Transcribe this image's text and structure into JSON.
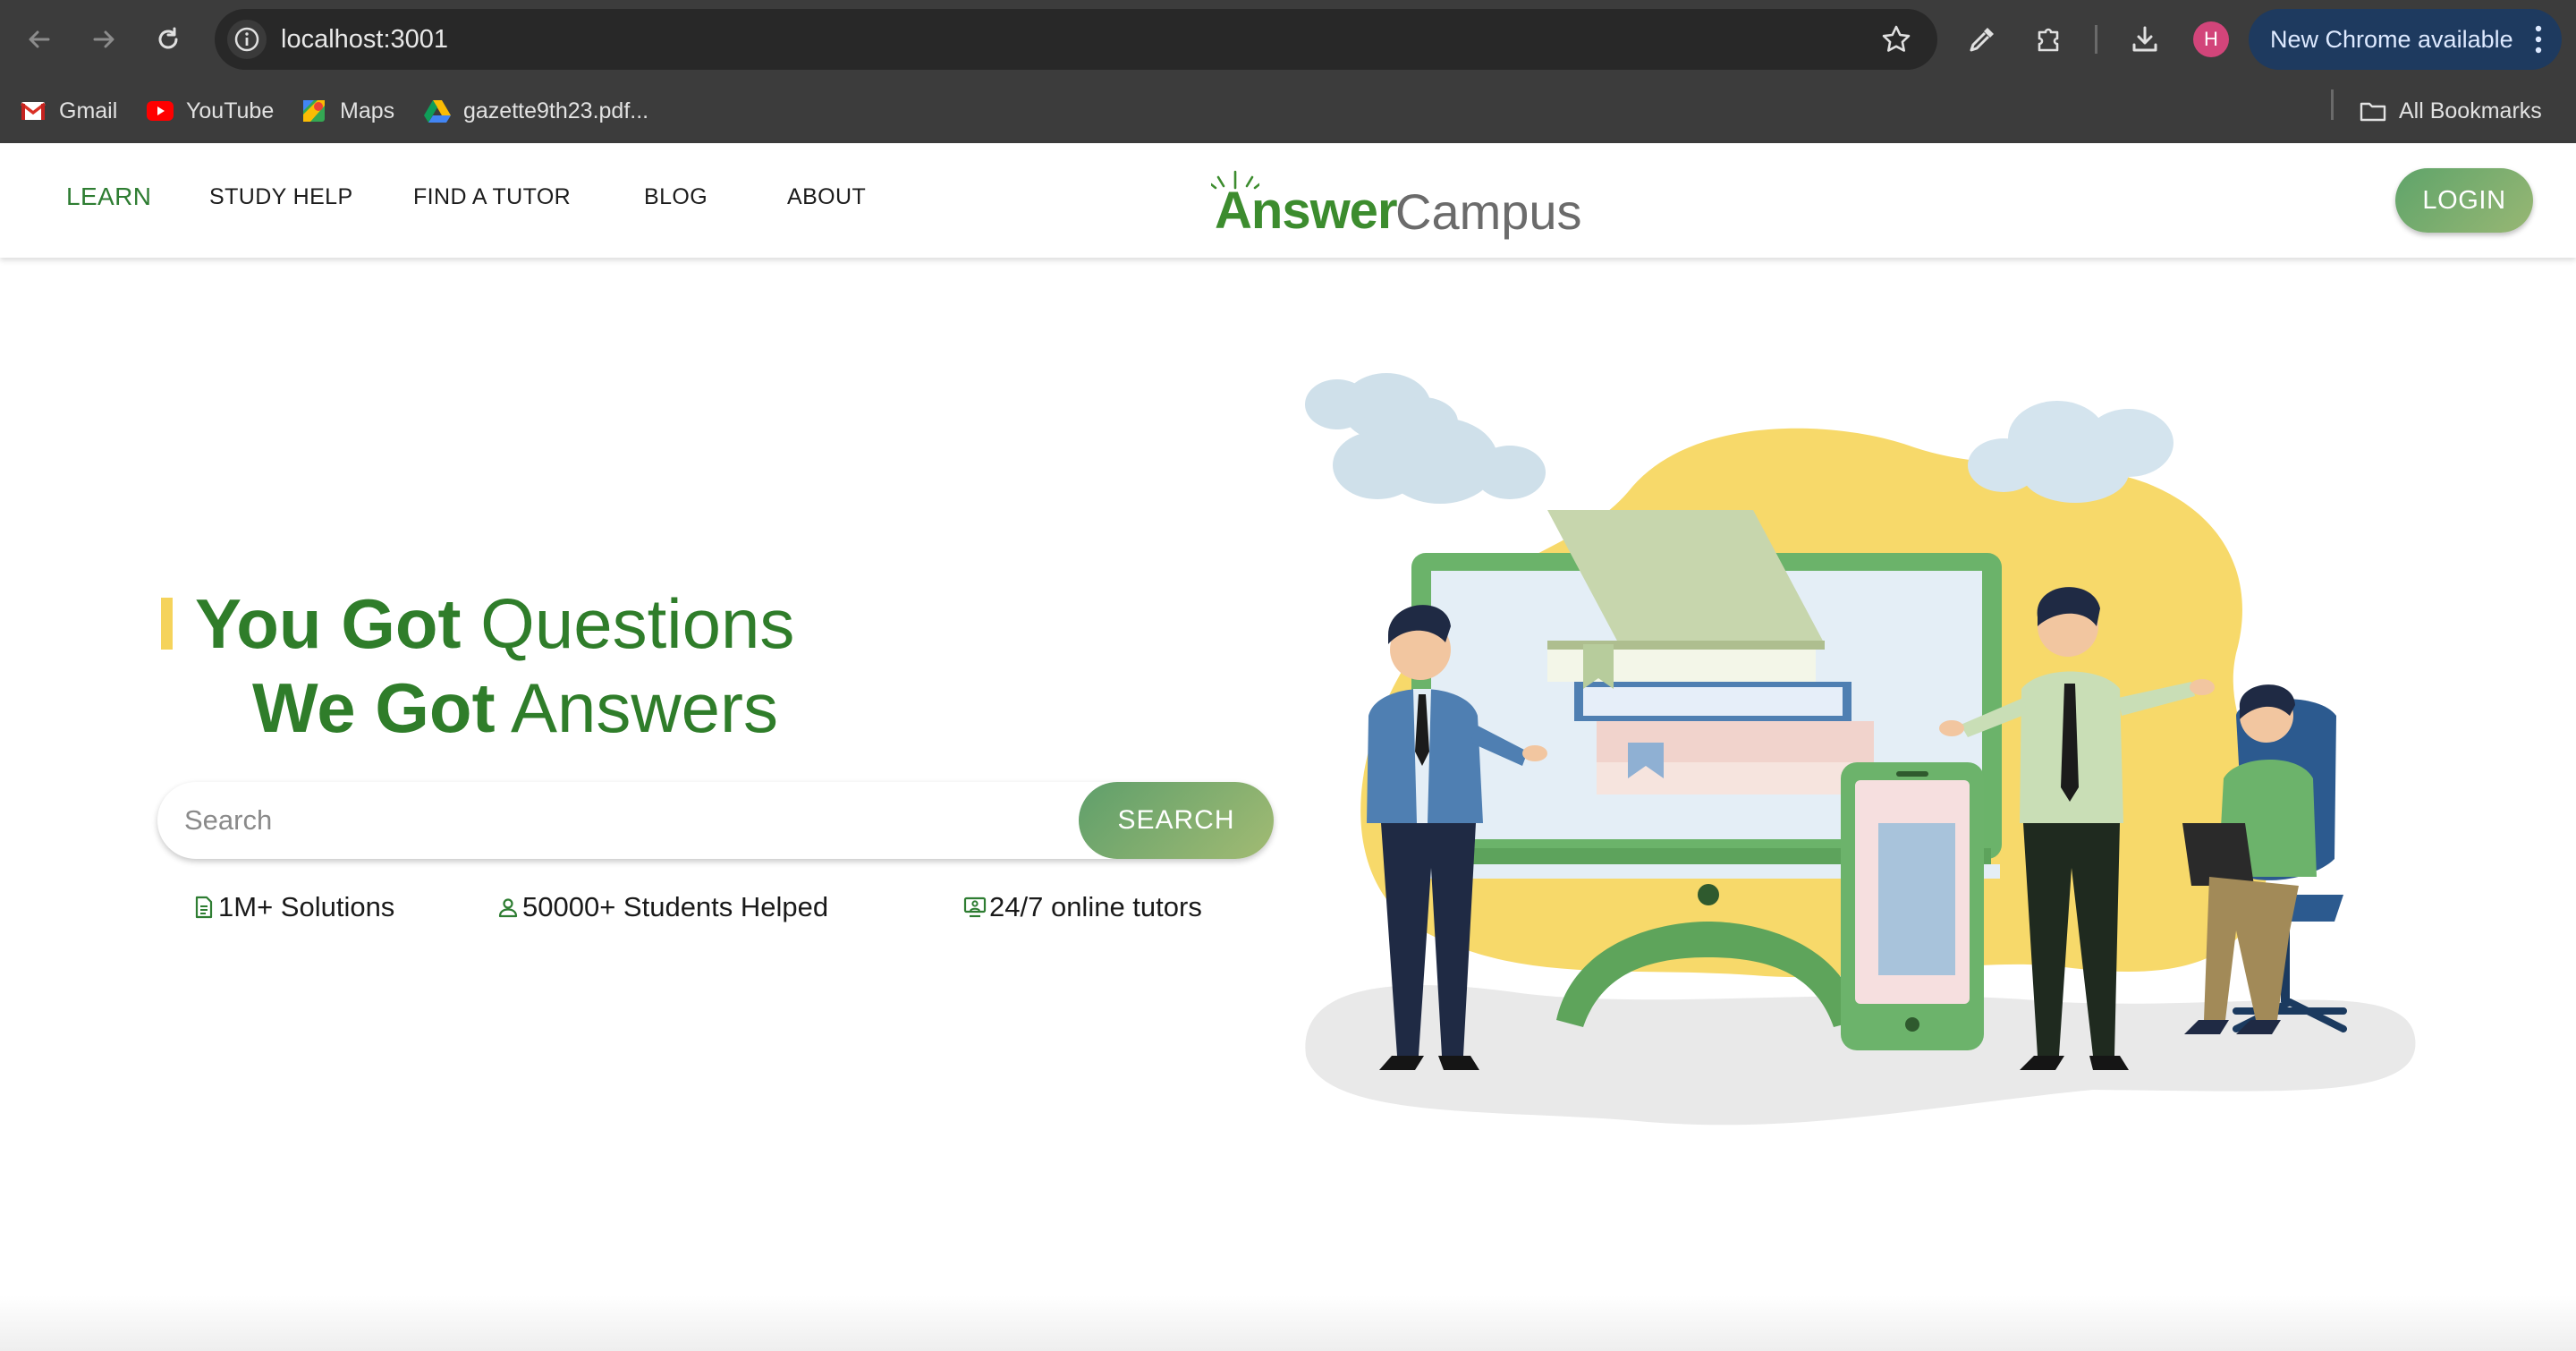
{
  "browser": {
    "url": "localhost:3001",
    "update_label": "New Chrome available",
    "profile_initial": "H",
    "bookmarks": [
      {
        "label": "Gmail",
        "icon": "gmail-icon"
      },
      {
        "label": "YouTube",
        "icon": "youtube-icon"
      },
      {
        "label": "Maps",
        "icon": "maps-icon"
      },
      {
        "label": "gazette9th23.pdf...",
        "icon": "google-drive-icon"
      }
    ],
    "all_bookmarks_label": "All Bookmarks"
  },
  "nav": {
    "items": [
      {
        "label": "LEARN",
        "active": true
      },
      {
        "label": "STUDY HELP"
      },
      {
        "label": "FIND A TUTOR"
      },
      {
        "label": "BLOG"
      },
      {
        "label": "ABOUT"
      }
    ],
    "logo": {
      "bold": "Answer",
      "light": "Campus"
    },
    "login_label": "LOGIN"
  },
  "hero": {
    "line1_bold": "You Got",
    "line1_light": "Questions",
    "line2_bold": "We Got",
    "line2_light": "Answers",
    "search_placeholder": "Search",
    "search_button": "SEARCH",
    "stats": [
      {
        "label": "1M+ Solutions",
        "icon": "document-icon"
      },
      {
        "label": "50000+ Students Helped",
        "icon": "user-icon"
      },
      {
        "label": "24/7 online tutors",
        "icon": "monitor-icon"
      }
    ]
  },
  "colors": {
    "brand_green": "#2f7d2a",
    "accent_yellow": "#f5d35b",
    "button_gradient_start": "#5fa46a",
    "button_gradient_end": "#98b774"
  }
}
